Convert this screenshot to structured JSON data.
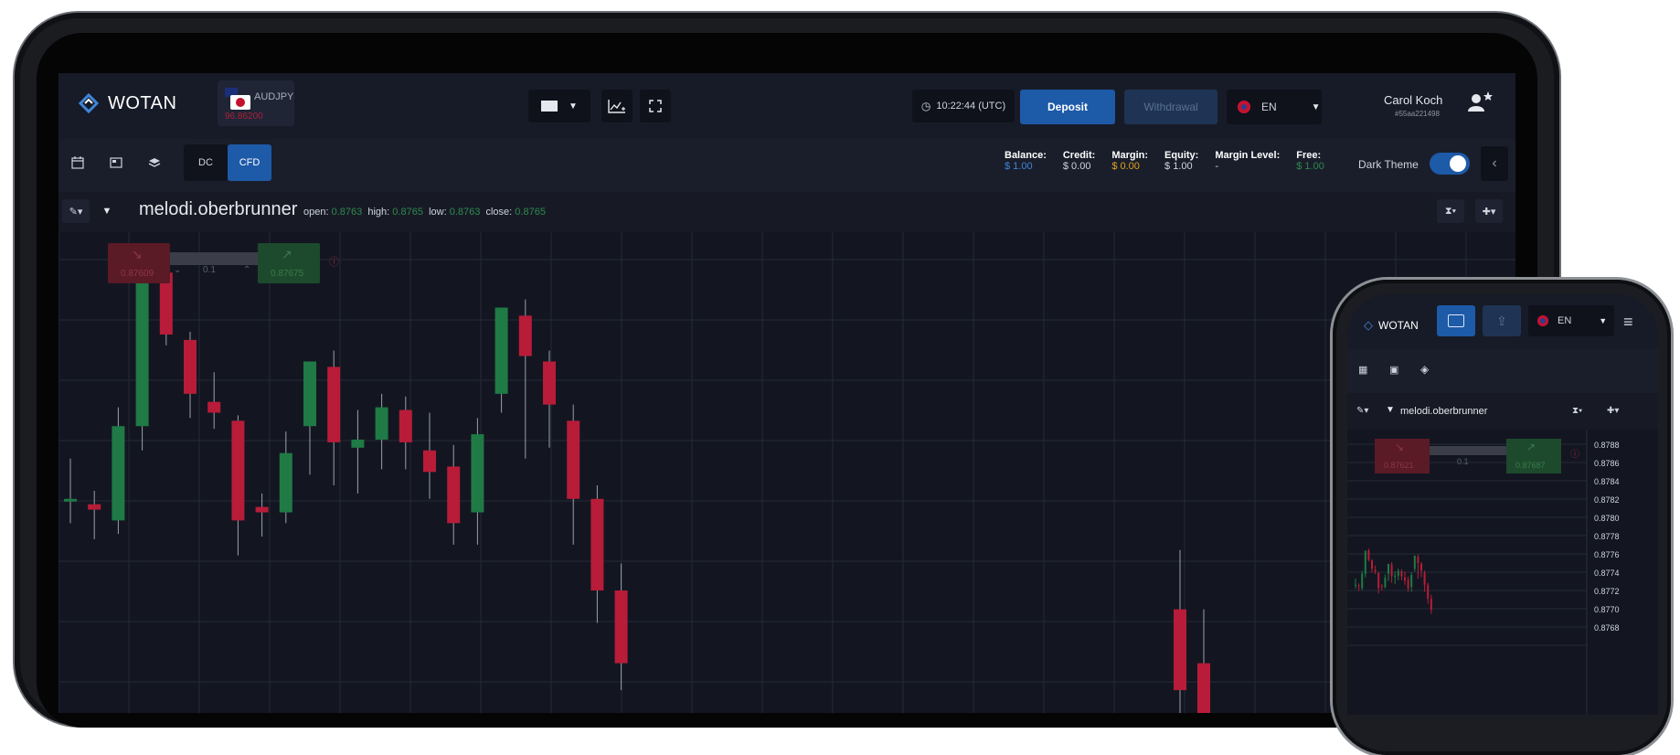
{
  "brand": {
    "name": "WOTAN"
  },
  "instrument": {
    "symbol": "AUDJPY",
    "price": "96.86200"
  },
  "clock": {
    "time": "10:22:44 (UTC)"
  },
  "actions": {
    "deposit": "Deposit",
    "withdrawal": "Withdrawal"
  },
  "language": {
    "code": "EN"
  },
  "user": {
    "name": "Carol Koch",
    "id": "#55aa221498"
  },
  "mode_tabs": [
    {
      "label": "DC",
      "active": false
    },
    {
      "label": "CFD",
      "active": true
    }
  ],
  "account": [
    {
      "label": "Balance:",
      "value": "$ 1.00",
      "color": "#3f86d8"
    },
    {
      "label": "Credit:",
      "value": "$ 0.00",
      "color": "#cfd3dc"
    },
    {
      "label": "Margin:",
      "value": "$ 0.00",
      "color": "#e0a21b"
    },
    {
      "label": "Equity:",
      "value": "$ 1.00",
      "color": "#cfd3dc"
    },
    {
      "label": "Margin Level:",
      "value": "-",
      "color": "#cfd3dc"
    },
    {
      "label": "Free:",
      "value": "$ 1.00",
      "color": "#2e8a4e"
    }
  ],
  "theme": {
    "label": "Dark Theme",
    "enabled": true
  },
  "chart_header": {
    "name": "melodi.oberbrunner",
    "open_label": "open:",
    "open": "0.8763",
    "high_label": "high:",
    "high": "0.8765",
    "low_label": "low:",
    "low": "0.8763",
    "close_label": "close:",
    "close": "0.8765"
  },
  "trade_widget": {
    "sell_price": "0.87609",
    "lot": "0.1",
    "buy_price": "0.87675"
  },
  "phone": {
    "brand": "WOTAN",
    "language": "EN",
    "chart_name": "melodi.oberbrunner",
    "sell_price": "0.87621",
    "lot": "0.1",
    "buy_price": "0.87687",
    "price_axis": [
      "0.8788",
      "0.8786",
      "0.8784",
      "0.8782",
      "0.8780",
      "0.8778",
      "0.8776",
      "0.8774",
      "0.8772",
      "0.8770",
      "0.8768"
    ]
  },
  "colors": {
    "up": "#1f7a45",
    "down": "#b81c38",
    "accent": "#1d5aa8",
    "bg": "#131621"
  },
  "chart_data": {
    "type": "candlestick",
    "title": "",
    "candles": [
      {
        "o": 0.873,
        "h": 0.8746,
        "l": 0.8722,
        "c": 0.8731
      },
      {
        "o": 0.8729,
        "h": 0.8734,
        "l": 0.8716,
        "c": 0.8727
      },
      {
        "o": 0.8723,
        "h": 0.8765,
        "l": 0.8718,
        "c": 0.8758
      },
      {
        "o": 0.8758,
        "h": 0.8815,
        "l": 0.8749,
        "c": 0.8813
      },
      {
        "o": 0.8815,
        "h": 0.8819,
        "l": 0.8788,
        "c": 0.8792
      },
      {
        "o": 0.879,
        "h": 0.8793,
        "l": 0.8761,
        "c": 0.877
      },
      {
        "o": 0.8767,
        "h": 0.8778,
        "l": 0.8757,
        "c": 0.8763
      },
      {
        "o": 0.876,
        "h": 0.8762,
        "l": 0.871,
        "c": 0.8723
      },
      {
        "o": 0.8728,
        "h": 0.8733,
        "l": 0.8717,
        "c": 0.8726
      },
      {
        "o": 0.8726,
        "h": 0.8756,
        "l": 0.8722,
        "c": 0.8748
      },
      {
        "o": 0.8758,
        "h": 0.8768,
        "l": 0.874,
        "c": 0.8782
      },
      {
        "o": 0.878,
        "h": 0.8786,
        "l": 0.8736,
        "c": 0.8752
      },
      {
        "o": 0.875,
        "h": 0.8764,
        "l": 0.8733,
        "c": 0.8753
      },
      {
        "o": 0.8753,
        "h": 0.877,
        "l": 0.8742,
        "c": 0.8765
      },
      {
        "o": 0.8764,
        "h": 0.8769,
        "l": 0.8742,
        "c": 0.8752
      },
      {
        "o": 0.8749,
        "h": 0.8763,
        "l": 0.8731,
        "c": 0.8741
      },
      {
        "o": 0.8743,
        "h": 0.8751,
        "l": 0.8714,
        "c": 0.8722
      },
      {
        "o": 0.8726,
        "h": 0.8761,
        "l": 0.8714,
        "c": 0.8755
      },
      {
        "o": 0.877,
        "h": 0.8791,
        "l": 0.8763,
        "c": 0.8802
      },
      {
        "o": 0.8799,
        "h": 0.8805,
        "l": 0.8746,
        "c": 0.8784
      },
      {
        "o": 0.8782,
        "h": 0.8786,
        "l": 0.875,
        "c": 0.8766
      },
      {
        "o": 0.876,
        "h": 0.8766,
        "l": 0.8714,
        "c": 0.8731
      },
      {
        "o": 0.8731,
        "h": 0.8736,
        "l": 0.8685,
        "c": 0.8697
      },
      {
        "o": 0.8697,
        "h": 0.8707,
        "l": 0.866,
        "c": 0.867
      }
    ]
  }
}
